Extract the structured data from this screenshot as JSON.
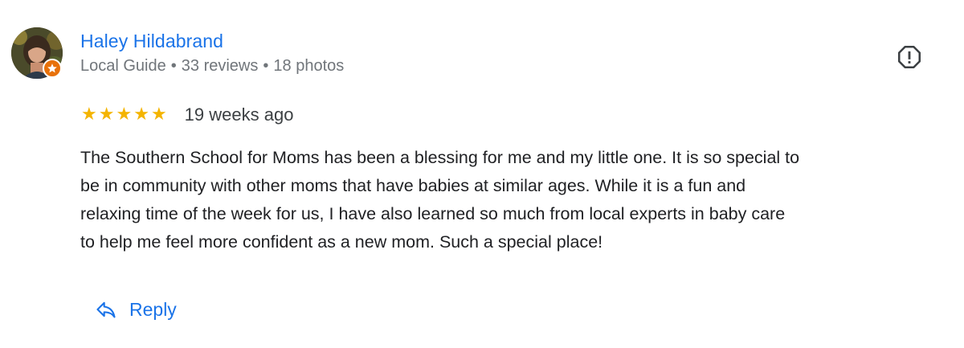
{
  "reviewer": {
    "name": "Haley Hildabrand",
    "badge": "Local Guide",
    "reviews_count": "33 reviews",
    "photos_count": "18 photos",
    "separator": "•"
  },
  "rating": {
    "stars": 5,
    "star_glyph": "★",
    "date": "19 weeks ago"
  },
  "review": {
    "text": "The Southern School for Moms has been a blessing for me and my little one. It is so special to\nbe in community with other moms that have babies at similar ages. While it is a fun and\nrelaxing time of the week for us, I have also learned so much from local experts in baby care\nto help me feel more confident as a new mom. Such a special place!"
  },
  "actions": {
    "reply_label": "Reply",
    "reply_icon": "reply-icon",
    "flag_icon": "report-icon"
  },
  "colors": {
    "link": "#1a73e8",
    "star": "#f4b400",
    "guide_badge": "#e8710a",
    "meta_text": "#70757a"
  }
}
